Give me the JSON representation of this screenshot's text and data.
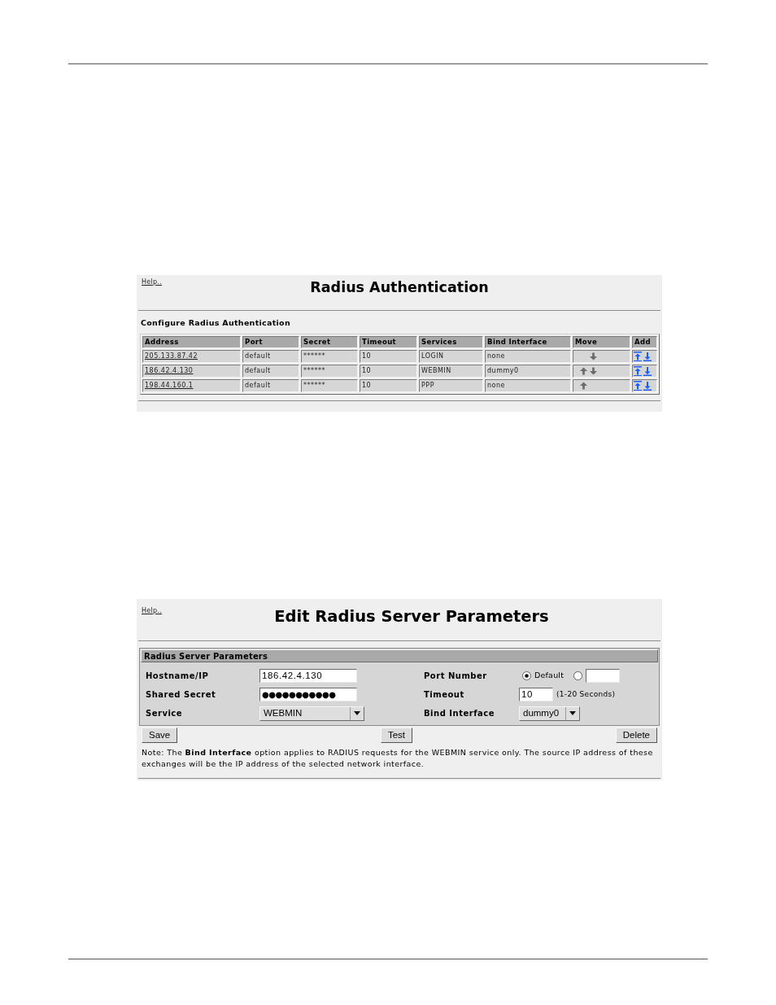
{
  "auth_panel": {
    "help_link": "Help..",
    "title": "Radius Authentication",
    "subtitle": "Configure Radius Authentication",
    "table": {
      "columns": [
        "Address",
        "Port",
        "Secret",
        "Timeout",
        "Services",
        "Bind Interface",
        "Move",
        "Add"
      ],
      "rows": [
        {
          "cells": [
            "205.133.87.42",
            "default",
            "******",
            "10",
            "LOGIN",
            "none"
          ],
          "can_move_up": false,
          "can_move_down": true
        },
        {
          "cells": [
            "186.42.4.130",
            "default",
            "******",
            "10",
            "WEBMIN",
            "dummy0"
          ],
          "can_move_up": true,
          "can_move_down": true
        },
        {
          "cells": [
            "198.44.160.1",
            "default",
            "******",
            "10",
            "PPP",
            "none"
          ],
          "can_move_up": true,
          "can_move_down": false
        }
      ]
    }
  },
  "edit_panel": {
    "help_link": "Help..",
    "title": "Edit Radius Server Parameters",
    "section_title": "Radius Server Parameters",
    "rows": [
      {
        "fields": [
          {
            "kind": "text",
            "label": "Hostname/IP",
            "value": "186.42.4.130"
          },
          {
            "kind": "port",
            "label": "Port Number",
            "options": [
              {
                "kind": "preset",
                "label": "Default",
                "selected": true
              },
              {
                "kind": "custom",
                "selected": false
              }
            ]
          }
        ]
      },
      {
        "fields": [
          {
            "kind": "password",
            "label": "Shared Secret",
            "value": "●●●●●●●●●●●"
          },
          {
            "kind": "text",
            "label": "Timeout",
            "value": "10",
            "hint": "(1-20 Seconds)"
          }
        ]
      },
      {
        "fields": [
          {
            "kind": "select",
            "label": "Service",
            "value": "WEBMIN"
          },
          {
            "kind": "select",
            "label": "Bind Interface",
            "value": "dummy0"
          }
        ]
      }
    ],
    "buttons": [
      "Save",
      "Test",
      "Delete"
    ],
    "note": "Note: The **Bind Interface** option applies to RADIUS requests for the WEBMIN service only. The source IP address of these exchanges will be the IP address of the selected network interface."
  }
}
